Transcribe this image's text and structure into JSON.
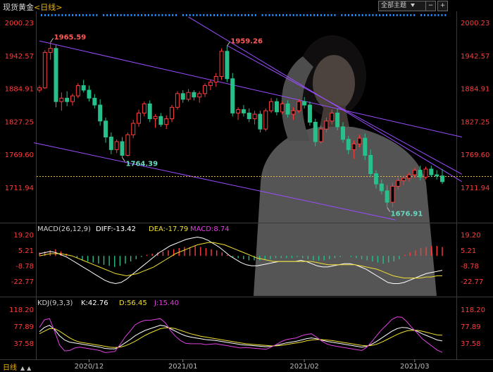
{
  "header": {
    "symbol": "现货黄金",
    "period_label": "<日线>",
    "mode_button": "全部主题",
    "mode_icon": "triangle-down",
    "minus_icon": "−",
    "plus_icon": "+"
  },
  "footer": {
    "period_tab": "日线",
    "prev_icon": "▲",
    "next_icon": "▲"
  },
  "colors": {
    "up": "#ff3c3c",
    "down": "#27c08a",
    "price_axis": "#ff3c3c",
    "channel": "#9a4dff",
    "white_line": "#ffffff",
    "yellow_line": "#f0e030",
    "magenta_line": "#e040e0",
    "current_price": "#e6b64c"
  },
  "main_chart": {
    "y_ticks": [
      "2000.23",
      "1942.57",
      "1884.91",
      "1827.25",
      "1769.60",
      "1711.94"
    ],
    "annotations": {
      "high1": "1965.59",
      "high2": "1959.26",
      "low1": "1764.39",
      "low2": "1676.91"
    }
  },
  "macd_panel": {
    "label": "MACD(26,12,9)",
    "diff": "DIFF:-13.42",
    "dea": "DEA:-17.79",
    "macd": "MACD:8.74",
    "y_ticks": [
      "19.20",
      "5.21",
      "-8.78",
      "-22.77"
    ]
  },
  "kdj_panel": {
    "label": "KDJ(9,3,3)",
    "k": "K:42.76",
    "d": "D:56.45",
    "j": "J:15.40",
    "y_ticks": [
      "118.20",
      "77.89",
      "37.58"
    ],
    "y_ticks_right": [
      "118.20",
      "77.89",
      "37.58"
    ]
  },
  "x_axis": [
    "2020/12",
    "2021/01",
    "2021/02",
    "2021/03"
  ],
  "chart_data": [
    {
      "type": "candlestick",
      "title": "现货黄金<日线>",
      "ylim": [
        1650,
        2005
      ],
      "candles": [
        {
          "o": 1882,
          "h": 1890,
          "l": 1878,
          "c": 1886
        },
        {
          "o": 1886,
          "h": 1952,
          "l": 1884,
          "c": 1948
        },
        {
          "o": 1948,
          "h": 1966,
          "l": 1935,
          "c": 1955
        },
        {
          "o": 1955,
          "h": 1962,
          "l": 1852,
          "c": 1862
        },
        {
          "o": 1862,
          "h": 1878,
          "l": 1846,
          "c": 1868
        },
        {
          "o": 1868,
          "h": 1880,
          "l": 1854,
          "c": 1862
        },
        {
          "o": 1862,
          "h": 1876,
          "l": 1855,
          "c": 1872
        },
        {
          "o": 1872,
          "h": 1894,
          "l": 1868,
          "c": 1890
        },
        {
          "o": 1890,
          "h": 1900,
          "l": 1878,
          "c": 1882
        },
        {
          "o": 1882,
          "h": 1890,
          "l": 1862,
          "c": 1868
        },
        {
          "o": 1868,
          "h": 1875,
          "l": 1850,
          "c": 1856
        },
        {
          "o": 1856,
          "h": 1866,
          "l": 1820,
          "c": 1828
        },
        {
          "o": 1828,
          "h": 1834,
          "l": 1790,
          "c": 1800
        },
        {
          "o": 1800,
          "h": 1808,
          "l": 1770,
          "c": 1778
        },
        {
          "o": 1778,
          "h": 1796,
          "l": 1772,
          "c": 1792
        },
        {
          "o": 1792,
          "h": 1800,
          "l": 1764,
          "c": 1768
        },
        {
          "o": 1768,
          "h": 1808,
          "l": 1766,
          "c": 1804
        },
        {
          "o": 1804,
          "h": 1830,
          "l": 1798,
          "c": 1824
        },
        {
          "o": 1824,
          "h": 1848,
          "l": 1818,
          "c": 1842
        },
        {
          "o": 1842,
          "h": 1862,
          "l": 1836,
          "c": 1858
        },
        {
          "o": 1858,
          "h": 1864,
          "l": 1826,
          "c": 1832
        },
        {
          "o": 1832,
          "h": 1840,
          "l": 1816,
          "c": 1836
        },
        {
          "o": 1836,
          "h": 1842,
          "l": 1818,
          "c": 1822
        },
        {
          "o": 1822,
          "h": 1838,
          "l": 1814,
          "c": 1832
        },
        {
          "o": 1832,
          "h": 1856,
          "l": 1826,
          "c": 1852
        },
        {
          "o": 1852,
          "h": 1880,
          "l": 1848,
          "c": 1876
        },
        {
          "o": 1876,
          "h": 1882,
          "l": 1860,
          "c": 1866
        },
        {
          "o": 1866,
          "h": 1884,
          "l": 1862,
          "c": 1878
        },
        {
          "o": 1878,
          "h": 1882,
          "l": 1864,
          "c": 1870
        },
        {
          "o": 1870,
          "h": 1880,
          "l": 1860,
          "c": 1876
        },
        {
          "o": 1876,
          "h": 1894,
          "l": 1870,
          "c": 1890
        },
        {
          "o": 1890,
          "h": 1900,
          "l": 1882,
          "c": 1896
        },
        {
          "o": 1896,
          "h": 1912,
          "l": 1888,
          "c": 1906
        },
        {
          "o": 1906,
          "h": 1955,
          "l": 1900,
          "c": 1950
        },
        {
          "o": 1950,
          "h": 1959,
          "l": 1896,
          "c": 1902
        },
        {
          "o": 1902,
          "h": 1912,
          "l": 1836,
          "c": 1842
        },
        {
          "o": 1842,
          "h": 1852,
          "l": 1830,
          "c": 1848
        },
        {
          "o": 1848,
          "h": 1856,
          "l": 1836,
          "c": 1842
        },
        {
          "o": 1842,
          "h": 1850,
          "l": 1826,
          "c": 1832
        },
        {
          "o": 1832,
          "h": 1846,
          "l": 1822,
          "c": 1840
        },
        {
          "o": 1840,
          "h": 1846,
          "l": 1808,
          "c": 1814
        },
        {
          "o": 1814,
          "h": 1850,
          "l": 1810,
          "c": 1846
        },
        {
          "o": 1846,
          "h": 1868,
          "l": 1842,
          "c": 1862
        },
        {
          "o": 1862,
          "h": 1868,
          "l": 1838,
          "c": 1844
        },
        {
          "o": 1844,
          "h": 1862,
          "l": 1840,
          "c": 1858
        },
        {
          "o": 1858,
          "h": 1864,
          "l": 1834,
          "c": 1840
        },
        {
          "o": 1840,
          "h": 1852,
          "l": 1830,
          "c": 1846
        },
        {
          "o": 1846,
          "h": 1866,
          "l": 1842,
          "c": 1862
        },
        {
          "o": 1862,
          "h": 1870,
          "l": 1850,
          "c": 1856
        },
        {
          "o": 1856,
          "h": 1862,
          "l": 1820,
          "c": 1826
        },
        {
          "o": 1826,
          "h": 1832,
          "l": 1784,
          "c": 1792
        },
        {
          "o": 1792,
          "h": 1820,
          "l": 1788,
          "c": 1814
        },
        {
          "o": 1814,
          "h": 1834,
          "l": 1808,
          "c": 1828
        },
        {
          "o": 1828,
          "h": 1848,
          "l": 1822,
          "c": 1842
        },
        {
          "o": 1842,
          "h": 1850,
          "l": 1812,
          "c": 1818
        },
        {
          "o": 1818,
          "h": 1826,
          "l": 1790,
          "c": 1796
        },
        {
          "o": 1796,
          "h": 1802,
          "l": 1770,
          "c": 1778
        },
        {
          "o": 1778,
          "h": 1794,
          "l": 1762,
          "c": 1788
        },
        {
          "o": 1788,
          "h": 1804,
          "l": 1782,
          "c": 1798
        },
        {
          "o": 1798,
          "h": 1806,
          "l": 1760,
          "c": 1768
        },
        {
          "o": 1768,
          "h": 1778,
          "l": 1730,
          "c": 1736
        },
        {
          "o": 1736,
          "h": 1742,
          "l": 1710,
          "c": 1718
        },
        {
          "o": 1718,
          "h": 1726,
          "l": 1700,
          "c": 1706
        },
        {
          "o": 1706,
          "h": 1716,
          "l": 1678,
          "c": 1686
        },
        {
          "o": 1686,
          "h": 1720,
          "l": 1677,
          "c": 1714
        },
        {
          "o": 1714,
          "h": 1730,
          "l": 1708,
          "c": 1724
        },
        {
          "o": 1724,
          "h": 1732,
          "l": 1716,
          "c": 1728
        },
        {
          "o": 1728,
          "h": 1738,
          "l": 1722,
          "c": 1734
        },
        {
          "o": 1734,
          "h": 1746,
          "l": 1728,
          "c": 1742
        },
        {
          "o": 1742,
          "h": 1750,
          "l": 1724,
          "c": 1730
        },
        {
          "o": 1730,
          "h": 1748,
          "l": 1726,
          "c": 1744
        },
        {
          "o": 1744,
          "h": 1750,
          "l": 1730,
          "c": 1734
        },
        {
          "o": 1734,
          "h": 1742,
          "l": 1726,
          "c": 1732
        },
        {
          "o": 1732,
          "h": 1744,
          "l": 1718,
          "c": 1722
        }
      ]
    },
    {
      "type": "bar",
      "title": "MACD(26,12,9)",
      "ylim": [
        -30,
        25
      ],
      "values": [
        3,
        4,
        5,
        6,
        4,
        2,
        0,
        -2,
        -4,
        -5,
        -6,
        -7,
        -8,
        -9,
        -10,
        -9,
        -7,
        -5,
        -3,
        -1,
        1,
        2,
        3,
        4,
        5,
        6,
        7,
        8,
        8,
        9,
        8,
        7,
        6,
        5,
        3,
        1,
        -1,
        -2,
        -3,
        -4,
        -4,
        -4,
        -3,
        -3,
        -2,
        -2,
        -2,
        -2,
        -1,
        -2,
        -3,
        -4,
        -4,
        -4,
        -3,
        -2,
        -1,
        0,
        -1,
        -2,
        -3,
        -4,
        -5,
        -6,
        -7,
        -6,
        -5,
        -3,
        1,
        3,
        5,
        7,
        8,
        9,
        9,
        8
      ],
      "series": [
        {
          "name": "DIFF",
          "values": [
            2,
            3,
            4,
            3,
            1,
            -1,
            -4,
            -7,
            -10,
            -13,
            -16,
            -19,
            -22,
            -24,
            -25,
            -24,
            -21,
            -17,
            -13,
            -9,
            -5,
            -1,
            3,
            6,
            9,
            11,
            13,
            15,
            16,
            17,
            16,
            14,
            11,
            8,
            4,
            0,
            -3,
            -6,
            -8,
            -9,
            -9,
            -8,
            -7,
            -6,
            -5,
            -5,
            -5,
            -5,
            -4,
            -5,
            -7,
            -9,
            -10,
            -10,
            -9,
            -8,
            -7,
            -7,
            -8,
            -10,
            -12,
            -15,
            -18,
            -21,
            -24,
            -25,
            -25,
            -24,
            -22,
            -20,
            -18,
            -16,
            -15,
            -14,
            -13
          ]
        },
        {
          "name": "DEA",
          "values": [
            0,
            1,
            2,
            2,
            2,
            1,
            0,
            -2,
            -4,
            -6,
            -8,
            -10,
            -12,
            -14,
            -16,
            -17,
            -18,
            -17,
            -16,
            -14,
            -12,
            -10,
            -7,
            -4,
            -1,
            2,
            4,
            6,
            8,
            10,
            11,
            12,
            12,
            11,
            10,
            8,
            6,
            4,
            2,
            0,
            -2,
            -3,
            -4,
            -5,
            -5,
            -5,
            -5,
            -5,
            -5,
            -5,
            -5,
            -6,
            -7,
            -8,
            -8,
            -8,
            -8,
            -8,
            -8,
            -9,
            -10,
            -11,
            -12,
            -14,
            -16,
            -18,
            -19,
            -20,
            -20,
            -20,
            -20,
            -19,
            -19,
            -18,
            -18
          ]
        }
      ]
    },
    {
      "type": "line",
      "title": "KDJ(9,3,3)",
      "ylim": [
        0,
        130
      ],
      "series": [
        {
          "name": "K",
          "values": [
            65,
            75,
            80,
            70,
            55,
            45,
            40,
            38,
            36,
            34,
            32,
            30,
            28,
            25,
            24,
            24,
            30,
            38,
            46,
            55,
            62,
            68,
            72,
            76,
            80,
            78,
            72,
            66,
            60,
            55,
            52,
            50,
            48,
            46,
            45,
            44,
            42,
            40,
            38,
            36,
            34,
            33,
            32,
            31,
            30,
            29,
            30,
            32,
            35,
            38,
            40,
            42,
            45,
            48,
            50,
            48,
            45,
            42,
            40,
            38,
            36,
            34,
            32,
            30,
            28,
            30,
            35,
            42,
            50,
            58,
            66,
            72,
            75,
            74,
            70,
            66,
            60,
            55,
            50,
            45,
            42.76
          ]
        },
        {
          "name": "D",
          "values": [
            60,
            66,
            72,
            72,
            66,
            58,
            50,
            44,
            40,
            38,
            36,
            34,
            32,
            30,
            28,
            27,
            28,
            31,
            36,
            42,
            49,
            56,
            62,
            67,
            72,
            74,
            74,
            72,
            68,
            64,
            60,
            57,
            54,
            52,
            50,
            48,
            46,
            44,
            42,
            40,
            38,
            36,
            35,
            34,
            33,
            32,
            31,
            31,
            32,
            34,
            36,
            38,
            40,
            43,
            45,
            46,
            46,
            45,
            44,
            42,
            40,
            38,
            36,
            34,
            32,
            31,
            32,
            35,
            40,
            46,
            52,
            58,
            63,
            67,
            68,
            68,
            66,
            63,
            60,
            57,
            56.45
          ]
        },
        {
          "name": "J",
          "values": [
            75,
            93,
            96,
            66,
            33,
            19,
            20,
            26,
            28,
            26,
            24,
            22,
            20,
            15,
            16,
            18,
            34,
            52,
            66,
            81,
            88,
            92,
            92,
            94,
            96,
            86,
            68,
            54,
            44,
            37,
            36,
            36,
            36,
            34,
            35,
            36,
            34,
            32,
            30,
            28,
            26,
            27,
            26,
            25,
            24,
            23,
            28,
            34,
            41,
            46,
            48,
            50,
            55,
            58,
            60,
            52,
            43,
            36,
            32,
            30,
            28,
            26,
            24,
            22,
            20,
            28,
            41,
            56,
            70,
            82,
            94,
            100,
            99,
            88,
            74,
            62,
            48,
            39,
            30,
            21,
            15.4
          ]
        }
      ]
    }
  ]
}
